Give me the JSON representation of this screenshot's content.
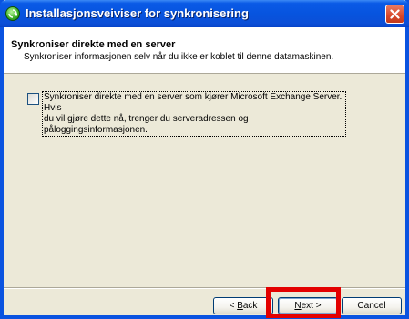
{
  "window": {
    "title": "Installasjonsveiviser for synkronisering"
  },
  "header": {
    "title": "Synkroniser direkte med en server",
    "subtitle": "Synkroniser informasjonen selv når du ikke er koblet til denne datamaskinen."
  },
  "option": {
    "checked": false,
    "label_line1": "Synkroniser direkte med en server som kjører Microsoft Exchange Server. Hvis",
    "label_line2": "du vil gjøre dette nå, trenger du serveradressen og påloggingsinformasjonen."
  },
  "buttons": {
    "back_prefix": "< ",
    "back_mnemonic": "B",
    "back_rest": "ack",
    "next_mnemonic": "N",
    "next_rest": "ext >",
    "cancel": "Cancel"
  },
  "colors": {
    "title_bar": "#0754df",
    "highlight": "#e30000",
    "dialog_bg": "#ece9d8"
  },
  "icons": {
    "title": "sync-wizard-icon",
    "close": "close-icon"
  }
}
